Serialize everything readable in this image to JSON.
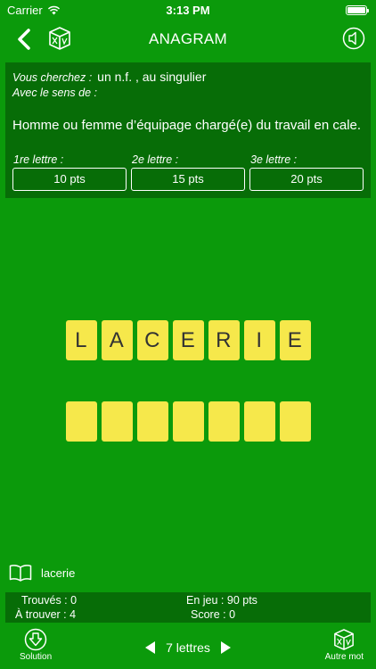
{
  "status_bar": {
    "carrier": "Carrier",
    "time": "3:13 PM"
  },
  "nav": {
    "title": "ANAGRAM",
    "icons": [
      "chevron-left-icon",
      "cube-icon",
      "speaker-icon"
    ]
  },
  "info": {
    "search_label": "Vous cherchez :",
    "search_value": "un n.f. , au singulier",
    "sense_label": "Avec le sens de :",
    "definition": "Homme ou femme d’équipage chargé(e) du travail en cale.",
    "hints": [
      {
        "label": "1re lettre :",
        "button": "10 pts"
      },
      {
        "label": "2e lettre :",
        "button": "15 pts"
      },
      {
        "label": "3e lettre :",
        "button": "20 pts"
      }
    ]
  },
  "scrambled_letters": [
    "L",
    "A",
    "C",
    "E",
    "R",
    "I",
    "E"
  ],
  "answer_slots": [
    "",
    "",
    "",
    "",
    "",
    "",
    ""
  ],
  "dictionary": {
    "icon": "book-icon",
    "word": "lacerie"
  },
  "stats": {
    "found": "Trouvés : 0",
    "to_find": "À trouver : 4",
    "at_stake": "En jeu : 90 pts",
    "score": "Score : 0"
  },
  "toolbar": {
    "solution_label": "Solution",
    "length_label": "7 lettres",
    "next_word_label": "Autre mot"
  },
  "colors": {
    "background": "#0b9a0b",
    "panel": "#076d07",
    "tile": "#f6e84b",
    "tile_text": "#333333"
  }
}
